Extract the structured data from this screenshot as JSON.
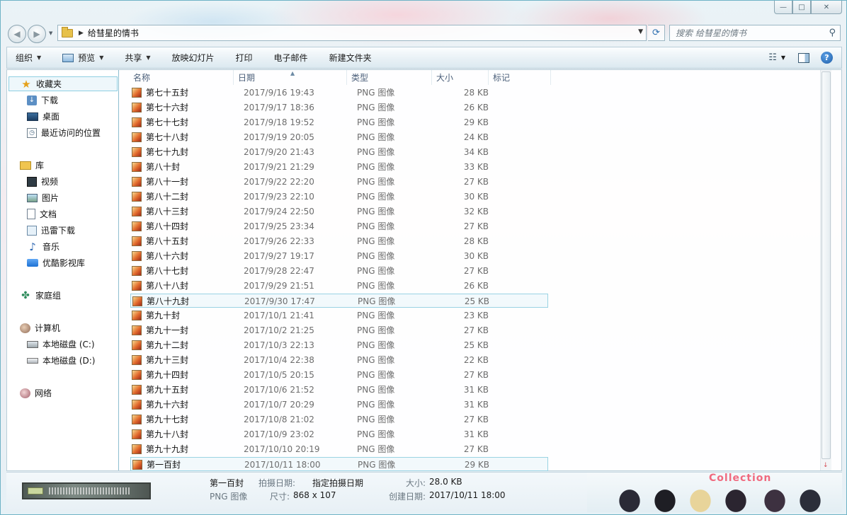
{
  "window": {
    "minimize_label": "—",
    "maximize_label": "□",
    "close_label": "✕"
  },
  "address": {
    "path_segment": "给彗星的情书",
    "search_placeholder": "搜索 给彗星的情书"
  },
  "toolbar": {
    "organize": "组织",
    "preview": "预览",
    "share": "共享",
    "slideshow": "放映幻灯片",
    "print": "打印",
    "email": "电子邮件",
    "new_folder": "新建文件夹"
  },
  "sidebar": {
    "favorites": "收藏夹",
    "downloads": "下载",
    "desktop": "桌面",
    "recent": "最近访问的位置",
    "libraries": "库",
    "videos": "视频",
    "pictures": "图片",
    "documents": "文档",
    "thunder": "迅雷下载",
    "music": "音乐",
    "youku": "优酷影视库",
    "homegroup": "家庭组",
    "computer": "计算机",
    "disk_c": "本地磁盘 (C:)",
    "disk_d": "本地磁盘 (D:)",
    "network": "网络"
  },
  "columns": {
    "name": "名称",
    "date": "日期",
    "type": "类型",
    "size": "大小",
    "tags": "标记"
  },
  "files": [
    {
      "name": "第七十五封",
      "date": "2017/9/16 19:43",
      "type": "PNG 图像",
      "size": "28 KB"
    },
    {
      "name": "第七十六封",
      "date": "2017/9/17 18:36",
      "type": "PNG 图像",
      "size": "26 KB"
    },
    {
      "name": "第七十七封",
      "date": "2017/9/18 19:52",
      "type": "PNG 图像",
      "size": "29 KB"
    },
    {
      "name": "第七十八封",
      "date": "2017/9/19 20:05",
      "type": "PNG 图像",
      "size": "24 KB"
    },
    {
      "name": "第七十九封",
      "date": "2017/9/20 21:43",
      "type": "PNG 图像",
      "size": "34 KB"
    },
    {
      "name": "第八十封",
      "date": "2017/9/21 21:29",
      "type": "PNG 图像",
      "size": "33 KB"
    },
    {
      "name": "第八十一封",
      "date": "2017/9/22 22:20",
      "type": "PNG 图像",
      "size": "27 KB"
    },
    {
      "name": "第八十二封",
      "date": "2017/9/23 22:10",
      "type": "PNG 图像",
      "size": "30 KB"
    },
    {
      "name": "第八十三封",
      "date": "2017/9/24 22:50",
      "type": "PNG 图像",
      "size": "32 KB"
    },
    {
      "name": "第八十四封",
      "date": "2017/9/25 23:34",
      "type": "PNG 图像",
      "size": "27 KB"
    },
    {
      "name": "第八十五封",
      "date": "2017/9/26 22:33",
      "type": "PNG 图像",
      "size": "28 KB"
    },
    {
      "name": "第八十六封",
      "date": "2017/9/27 19:17",
      "type": "PNG 图像",
      "size": "30 KB"
    },
    {
      "name": "第八十七封",
      "date": "2017/9/28 22:47",
      "type": "PNG 图像",
      "size": "27 KB"
    },
    {
      "name": "第八十八封",
      "date": "2017/9/29 21:51",
      "type": "PNG 图像",
      "size": "26 KB"
    },
    {
      "name": "第八十九封",
      "date": "2017/9/30 17:47",
      "type": "PNG 图像",
      "size": "25 KB"
    },
    {
      "name": "第九十封",
      "date": "2017/10/1 21:41",
      "type": "PNG 图像",
      "size": "23 KB"
    },
    {
      "name": "第九十一封",
      "date": "2017/10/2 21:25",
      "type": "PNG 图像",
      "size": "27 KB"
    },
    {
      "name": "第九十二封",
      "date": "2017/10/3 22:13",
      "type": "PNG 图像",
      "size": "25 KB"
    },
    {
      "name": "第九十三封",
      "date": "2017/10/4 22:38",
      "type": "PNG 图像",
      "size": "22 KB"
    },
    {
      "name": "第九十四封",
      "date": "2017/10/5 20:15",
      "type": "PNG 图像",
      "size": "27 KB"
    },
    {
      "name": "第九十五封",
      "date": "2017/10/6 21:52",
      "type": "PNG 图像",
      "size": "31 KB"
    },
    {
      "name": "第九十六封",
      "date": "2017/10/7 20:29",
      "type": "PNG 图像",
      "size": "31 KB"
    },
    {
      "name": "第九十七封",
      "date": "2017/10/8 21:02",
      "type": "PNG 图像",
      "size": "27 KB"
    },
    {
      "name": "第九十八封",
      "date": "2017/10/9 23:02",
      "type": "PNG 图像",
      "size": "31 KB"
    },
    {
      "name": "第九十九封",
      "date": "2017/10/10 20:19",
      "type": "PNG 图像",
      "size": "27 KB"
    },
    {
      "name": "第一百封",
      "date": "2017/10/11 18:00",
      "type": "PNG 图像",
      "size": "29 KB"
    }
  ],
  "details": {
    "name": "第一百封",
    "type": "PNG 图像",
    "taken_label": "拍摄日期:",
    "taken_value": "指定拍摄日期",
    "dimensions_label": "尺寸:",
    "dimensions_value": "868 x 107",
    "size_label": "大小:",
    "size_value": "28.0 KB",
    "created_label": "创建日期:",
    "created_value": "2017/10/11 18:00",
    "art_text": "Collection"
  }
}
